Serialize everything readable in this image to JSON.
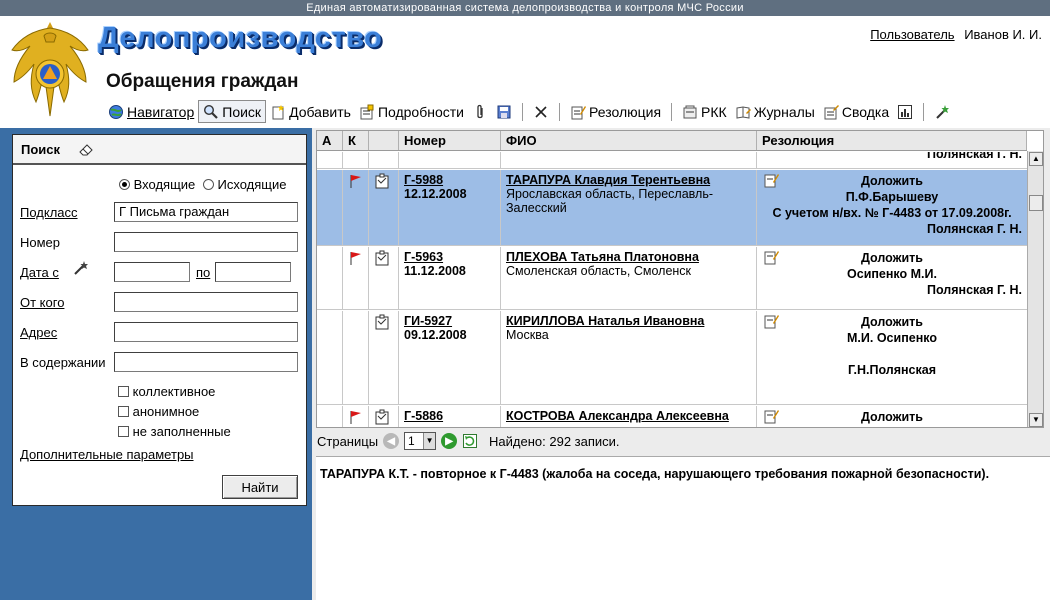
{
  "system_title": "Единая автоматизированная система делопроизводства и контроля МЧС России",
  "app_title": "Делопроизводство",
  "section_title": "Обращения граждан",
  "user": {
    "link_label": "Пользователь",
    "name": "Иванов И. И."
  },
  "toolbar": {
    "navigator": "Навигатор",
    "search": "Поиск",
    "add": "Добавить",
    "details": "Подробности",
    "resolution": "Резолюция",
    "rkk": "РКК",
    "journals": "Журналы",
    "summary": "Сводка"
  },
  "search_panel": {
    "title": "Поиск",
    "radio_incoming": "Входящие",
    "radio_outgoing": "Исходящие",
    "subclass_label": "Подкласс",
    "subclass_value": "Г   Письма граждан",
    "number_label": "Номер",
    "date_from_label": "Дата с",
    "date_to_label": "по",
    "from_label": "От кого",
    "address_label": "Адрес",
    "content_label": "В содержании",
    "chk_collective": "коллективное",
    "chk_anonymous": "анонимное",
    "chk_unfilled": "не заполненные",
    "extra_params": "Дополнительные параметры",
    "find_button": "Найти"
  },
  "table": {
    "headers": {
      "a": "А",
      "k": "К",
      "number": "Номер",
      "fio": "ФИО",
      "resolution": "Резолюция"
    },
    "top_partial": "Полянская Г. Н.",
    "rows": [
      {
        "number": "Г-5988",
        "date": "12.12.2008",
        "fio": "ТАРАПУРА Клавдия Терентьевна",
        "address": "Ярославская область, Переславль-Залесский",
        "res_title": "Доложить",
        "res_to": "П.Ф.Барышеву",
        "res_note": "С учетом н/вх. № Г-4483 от 17.09.2008г.",
        "res_author": "Полянская Г. Н."
      },
      {
        "number": "Г-5963",
        "date": "11.12.2008",
        "fio": "ПЛЕХОВА Татьяна Платоновна",
        "address": "Смоленская область, Смоленск",
        "res_title": "Доложить",
        "res_to": "Осипенко М.И.",
        "res_author": "Полянская Г. Н."
      },
      {
        "number": "ГИ-5927",
        "date": "09.12.2008",
        "fio": "КИРИЛЛОВА Наталья Ивановна",
        "address": "Москва",
        "res_title": "Доложить",
        "res_to": "М.И. Осипенко",
        "res_author": "Г.Н.Полянская"
      },
      {
        "number": "Г-5886",
        "fio": "КОСТРОВА Александра Алексеевна",
        "res_title": "Доложить"
      }
    ]
  },
  "pager": {
    "label": "Страницы",
    "page": "1",
    "found": "Найдено: 292 записи."
  },
  "summary_text": "ТАРАПУРА К.Т. - повторное к Г-4483 (жалоба на соседа, нарушающего требования пожарной безопасности).",
  "colors": {
    "sidebar": "#3a6ea5",
    "selected_row": "#9dbde6",
    "title_blue": "#3b7fd8"
  }
}
